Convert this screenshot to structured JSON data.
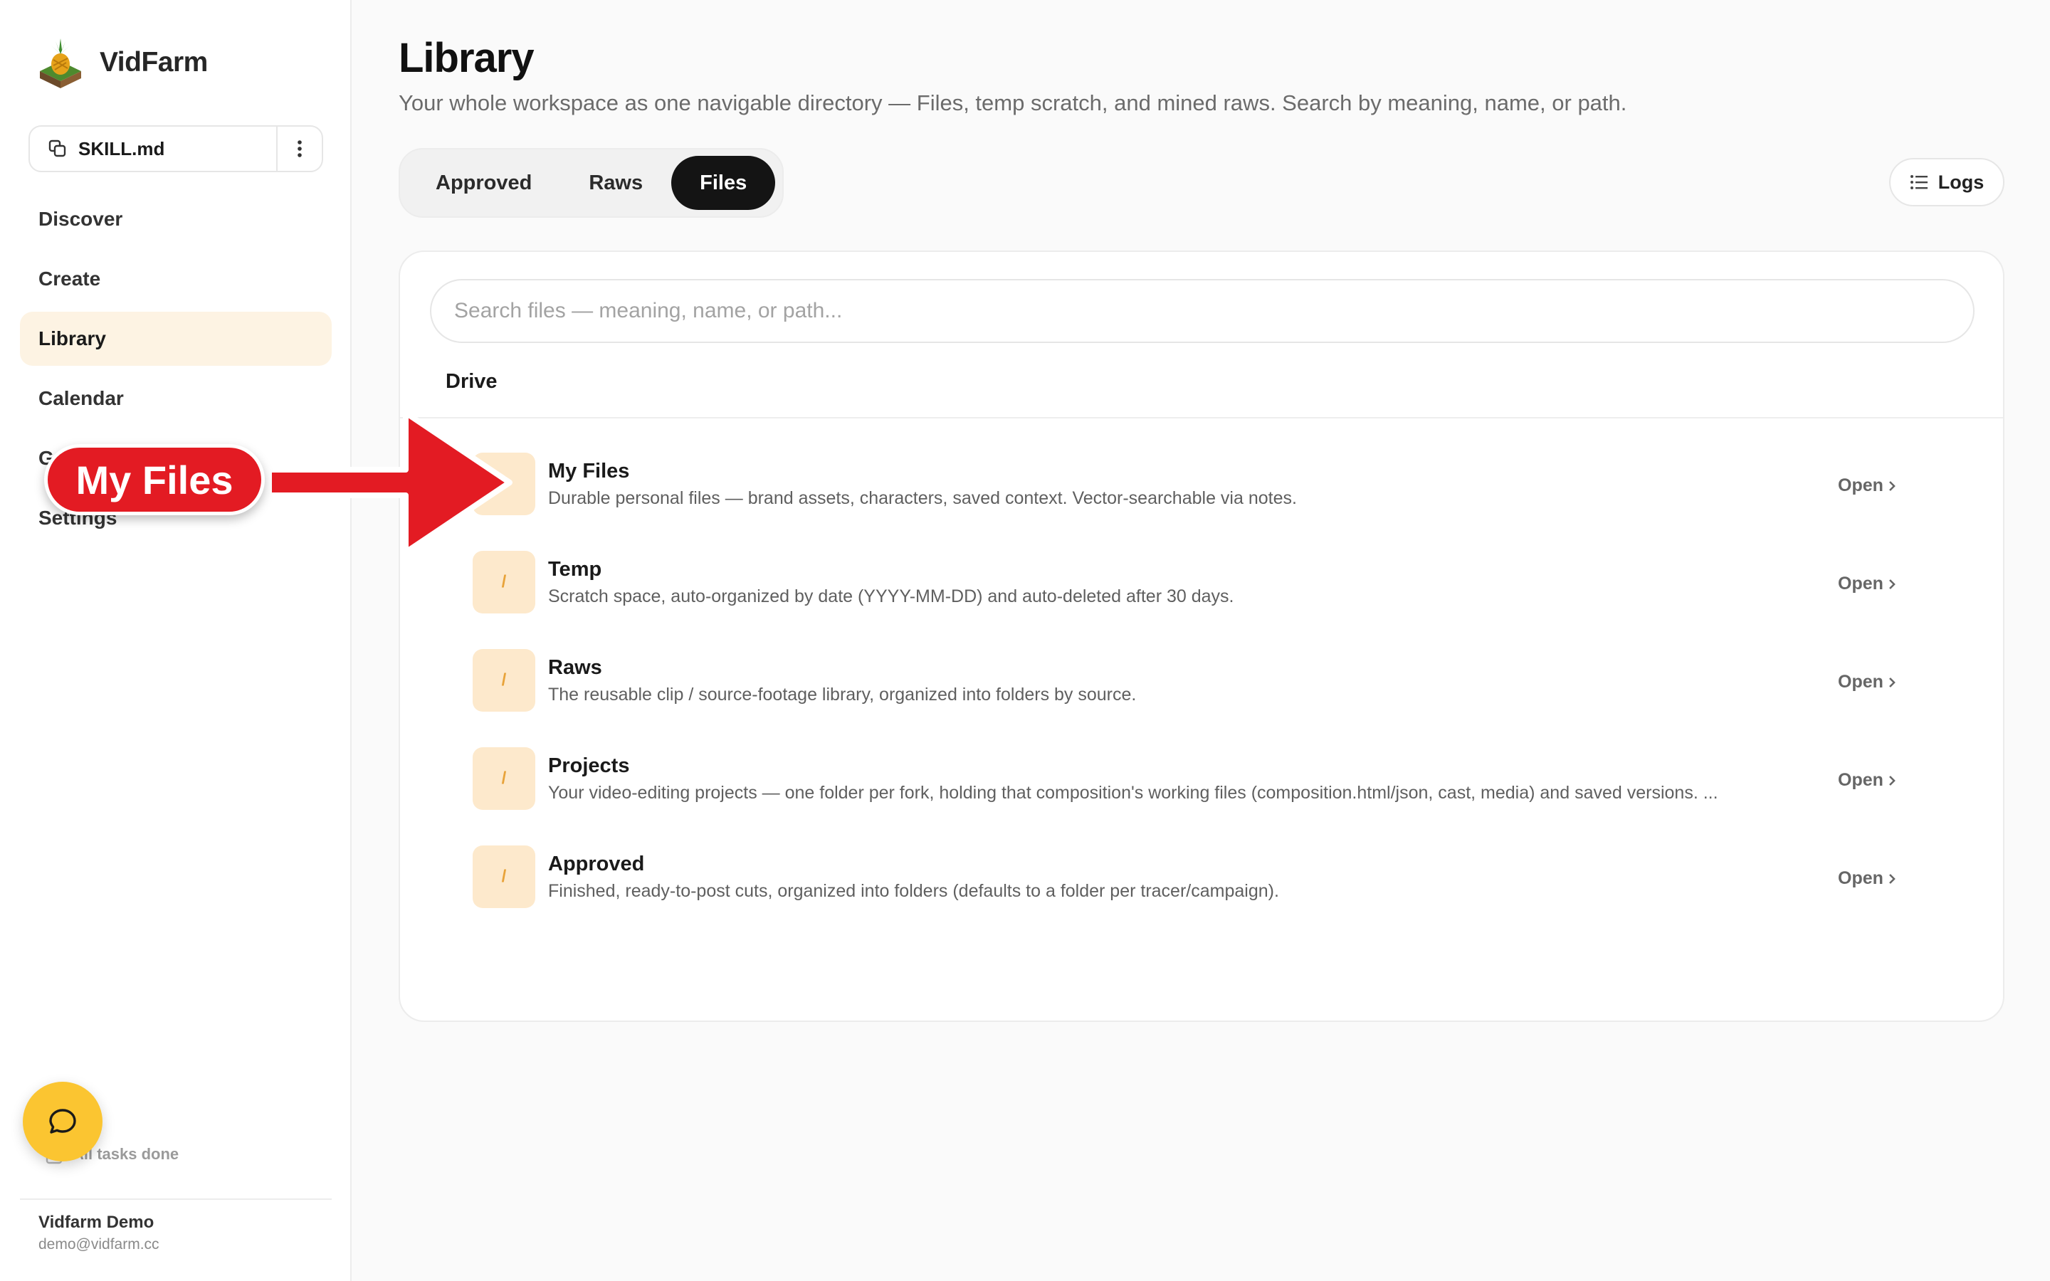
{
  "app": {
    "name": "VidFarm"
  },
  "sidebar": {
    "skill_file": "SKILL.md",
    "nav": [
      {
        "label": "Discover",
        "active": false
      },
      {
        "label": "Create",
        "active": false
      },
      {
        "label": "Library",
        "active": true
      },
      {
        "label": "Calendar",
        "active": false
      },
      {
        "label": "G",
        "active": false
      },
      {
        "label": "Settings",
        "active": false
      }
    ],
    "tasks_status": "All tasks done",
    "user": {
      "name": "Vidfarm Demo",
      "email": "demo@vidfarm.cc"
    }
  },
  "header": {
    "title": "Library",
    "subtitle": "Your whole workspace as one navigable directory — Files, temp scratch, and mined raws. Search by meaning, name, or path."
  },
  "tabs": [
    {
      "label": "Approved",
      "active": false
    },
    {
      "label": "Raws",
      "active": false
    },
    {
      "label": "Files",
      "active": true
    }
  ],
  "logs_label": "Logs",
  "search": {
    "placeholder": "Search files — meaning, name, or path..."
  },
  "section_title": "Drive",
  "folders": [
    {
      "icon": "/",
      "name": "My Files",
      "description": "Durable personal files — brand assets, characters, saved context. Vector-searchable via notes.",
      "action": "Open"
    },
    {
      "icon": "/",
      "name": "Temp",
      "description": "Scratch space, auto-organized by date (YYYY-MM-DD) and auto-deleted after 30 days.",
      "action": "Open"
    },
    {
      "icon": "/",
      "name": "Raws",
      "description": "The reusable clip / source-footage library, organized into folders by source.",
      "action": "Open"
    },
    {
      "icon": "/",
      "name": "Projects",
      "description": "Your video-editing projects — one folder per fork, holding that composition's working files (composition.html/json, cast, media) and saved versions. ...",
      "action": "Open"
    },
    {
      "icon": "/",
      "name": "Approved",
      "description": "Finished, ready-to-post cuts, organized into folders (defaults to a folder per tracer/campaign).",
      "action": "Open"
    }
  ],
  "annotation": {
    "label": "My Files"
  },
  "colors": {
    "accent_bg": "#fdf3e3",
    "folder_icon_bg": "#fde9cc",
    "chat_fab": "#fbc531",
    "annotation_red": "#e31b23",
    "active_tab": "#141414"
  },
  "icons": {
    "skill_copy": "copy-icon",
    "skill_more": "more-vertical-icon",
    "logs": "list-icon",
    "chat": "chat-bubble-icon",
    "tasks": "clipboard-icon",
    "open": "chevron-right-icon"
  }
}
